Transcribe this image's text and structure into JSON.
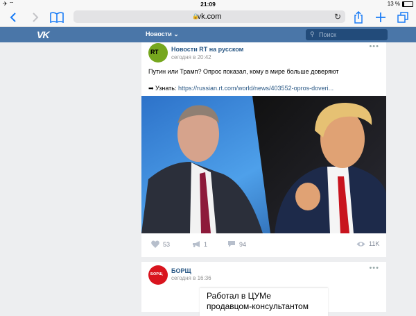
{
  "status_bar": {
    "time": "21:09",
    "battery": "13 %"
  },
  "browser": {
    "url": "vk.com"
  },
  "vk": {
    "nav_label": "Новости",
    "search_placeholder": "Поиск"
  },
  "posts": [
    {
      "author": "Новости RT на русском",
      "time": "сегодня в 20:42",
      "avatar_text": "RT",
      "text": "Путин или Трамп? Опрос показал, кому в мире больше доверяют",
      "link_prefix": "➡ Узнать:",
      "link": "https://russian.rt.com/world/news/403552-opros-doveri...",
      "likes": "53",
      "reposts": "1",
      "comments": "94",
      "views": "11K"
    },
    {
      "author": "БОРЩ",
      "time": "сегодня в 16:36",
      "avatar_text": "БОРЩ",
      "ad_line1": "Работал в ЦУМе",
      "ad_line2": "продавцом-консультантом"
    }
  ]
}
